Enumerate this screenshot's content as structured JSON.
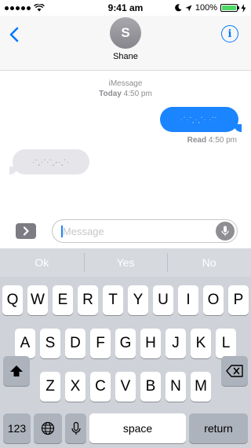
{
  "status_bar": {
    "time": "9:41 am",
    "battery": "100%",
    "battery_level": 1.0
  },
  "nav": {
    "avatar_initial": "S",
    "contact_name": "Shane"
  },
  "conversation": {
    "service": "iMessage",
    "day": "Today",
    "time": "4:50 pm",
    "outgoing_text": "·´·¨¸·¸´· ·¨´",
    "read_label": "Read",
    "read_time": "4:50 pm",
    "incoming_text": "·¨¸·´·¨¸-·¸´·"
  },
  "input": {
    "placeholder": "iMessage",
    "value": ""
  },
  "keyboard": {
    "predictions": [
      "Ok",
      "Yes",
      "No"
    ],
    "row1": [
      "Q",
      "W",
      "E",
      "R",
      "T",
      "Y",
      "U",
      "I",
      "O",
      "P"
    ],
    "row2": [
      "A",
      "S",
      "D",
      "F",
      "G",
      "H",
      "J",
      "K",
      "L"
    ],
    "row3": [
      "Z",
      "X",
      "C",
      "V",
      "B",
      "N",
      "M"
    ],
    "numbers_label": "123",
    "space_label": "space",
    "return_label": "return"
  },
  "colors": {
    "accent": "#007aff",
    "outgoing_bubble": "#1b84ff",
    "incoming_bubble": "#e5e5ea",
    "battery_fill": "#4cd964"
  }
}
